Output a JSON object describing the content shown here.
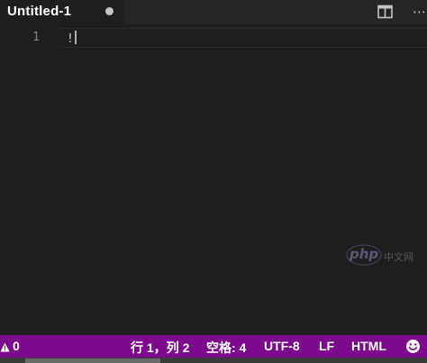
{
  "tab": {
    "title": "Untitled-1",
    "dirty_indicator": "dirty-dot-icon"
  },
  "toolbar": {
    "split_icon": "split-editor-icon",
    "more_icon": "more-actions-icon"
  },
  "editor": {
    "lines": [
      {
        "number": "1",
        "text": "!"
      }
    ]
  },
  "watermark": {
    "text": "php",
    "cn_text": "中文网"
  },
  "status_bar": {
    "background_color": "#7d0a8d",
    "problems_icon": "warning-icon",
    "problems_count": "0",
    "cursor_position": "行 1，列 2",
    "indentation": "空格: 4",
    "encoding": "UTF-8",
    "eol": "LF",
    "language_mode": "HTML",
    "feedback_icon": "smiley-feedback-icon"
  }
}
